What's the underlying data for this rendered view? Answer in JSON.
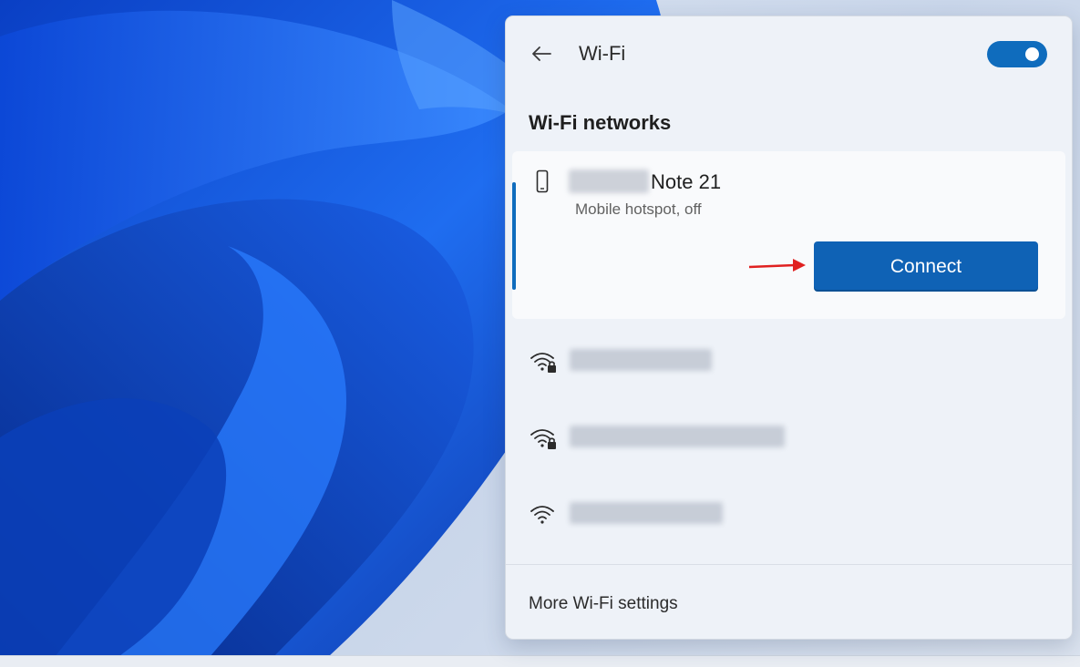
{
  "header": {
    "title": "Wi-Fi",
    "back_icon": "arrow-left-icon",
    "wifi_enabled": true
  },
  "section_title": "Wi-Fi networks",
  "selected_network": {
    "name_visible": "Note 21",
    "name_redacted": true,
    "status": "Mobile hotspot, off",
    "icon": "phone-icon",
    "connect_label": "Connect"
  },
  "networks": [
    {
      "icon": "wifi-secured-icon",
      "secured": true,
      "name_redacted": true
    },
    {
      "icon": "wifi-secured-icon",
      "secured": true,
      "name_redacted": true
    },
    {
      "icon": "wifi-icon",
      "secured": false,
      "name_redacted": true
    }
  ],
  "footer": {
    "more_settings_label": "More Wi-Fi settings"
  },
  "colors": {
    "accent": "#0f6cbd",
    "annotation_arrow": "#e02020"
  }
}
